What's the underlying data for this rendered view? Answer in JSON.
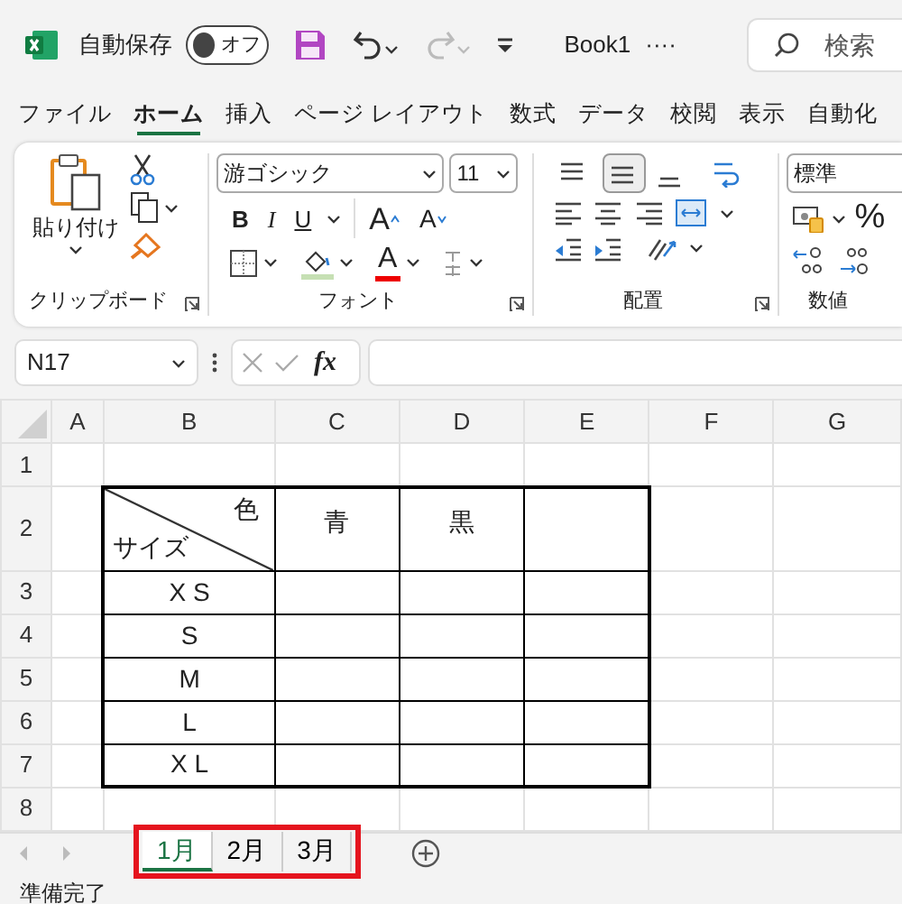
{
  "title_bar": {
    "autosave_label": "自動保存",
    "autosave_toggle": {
      "label": "オフ",
      "on": false
    },
    "quick_access": [
      {
        "kind": "save",
        "disabled": false
      },
      {
        "kind": "undo",
        "disabled": false
      },
      {
        "kind": "redo",
        "disabled": true
      },
      {
        "kind": "customize",
        "disabled": false
      }
    ],
    "document_title": "Book1",
    "more": "····",
    "search": {
      "placeholder": "検索"
    }
  },
  "ribbon_tabs": [
    {
      "label": "ファイル",
      "selected": false
    },
    {
      "label": "ホーム",
      "selected": true
    },
    {
      "label": "挿入",
      "selected": false
    },
    {
      "label": "ページ レイアウト",
      "selected": false
    },
    {
      "label": "数式",
      "selected": false
    },
    {
      "label": "データ",
      "selected": false
    },
    {
      "label": "校閲",
      "selected": false
    },
    {
      "label": "表示",
      "selected": false
    },
    {
      "label": "自動化",
      "selected": false
    }
  ],
  "ribbon": {
    "clipboard": {
      "paste_label": "貼り付け",
      "group_label": "クリップボード"
    },
    "font": {
      "font_name": "游ゴシック",
      "font_size": "11",
      "bold": "B",
      "italic": "I",
      "underline": "U",
      "grow_font": "A",
      "shrink_font": "A",
      "font_color": "A",
      "group_label": "フォント"
    },
    "alignment": {
      "vertical": [
        {
          "kind": "top",
          "selected": false
        },
        {
          "kind": "middle",
          "selected": true
        },
        {
          "kind": "bottom",
          "selected": false
        }
      ],
      "group_label": "配置"
    },
    "number": {
      "format": "標準",
      "percent": "%",
      "group_label": "数値"
    }
  },
  "formula_bar": {
    "name_box": "N17",
    "function_label": "fx"
  },
  "sheet": {
    "columns": [
      {
        "label": "A",
        "bordered": false
      },
      {
        "label": "B",
        "bordered": true
      },
      {
        "label": "C",
        "bordered": true
      },
      {
        "label": "D",
        "bordered": true
      },
      {
        "label": "E",
        "bordered": true
      },
      {
        "label": "F",
        "bordered": false
      },
      {
        "label": "G",
        "bordered": false
      }
    ],
    "rows": [
      {
        "header": "1",
        "bordered": false
      },
      {
        "header": "2",
        "bordered": true,
        "cells": {
          "B": {
            "top": "色",
            "bottom": "サイズ"
          },
          "C": "青",
          "D": "黒"
        }
      },
      {
        "header": "3",
        "bordered": true,
        "cells": {
          "B": "X S"
        }
      },
      {
        "header": "4",
        "bordered": true,
        "cells": {
          "B": "S"
        }
      },
      {
        "header": "5",
        "bordered": true,
        "cells": {
          "B": "M"
        }
      },
      {
        "header": "6",
        "bordered": true,
        "cells": {
          "B": "L"
        }
      },
      {
        "header": "7",
        "bordered": true,
        "cells": {
          "B": "X L"
        }
      },
      {
        "header": "8",
        "bordered": false
      }
    ]
  },
  "sheet_tabs": {
    "highlighted": true,
    "tabs": [
      {
        "label": "1月",
        "selected": true
      },
      {
        "label": "2月",
        "selected": false
      },
      {
        "label": "3月",
        "selected": false
      }
    ]
  },
  "status_bar": "準備完了"
}
